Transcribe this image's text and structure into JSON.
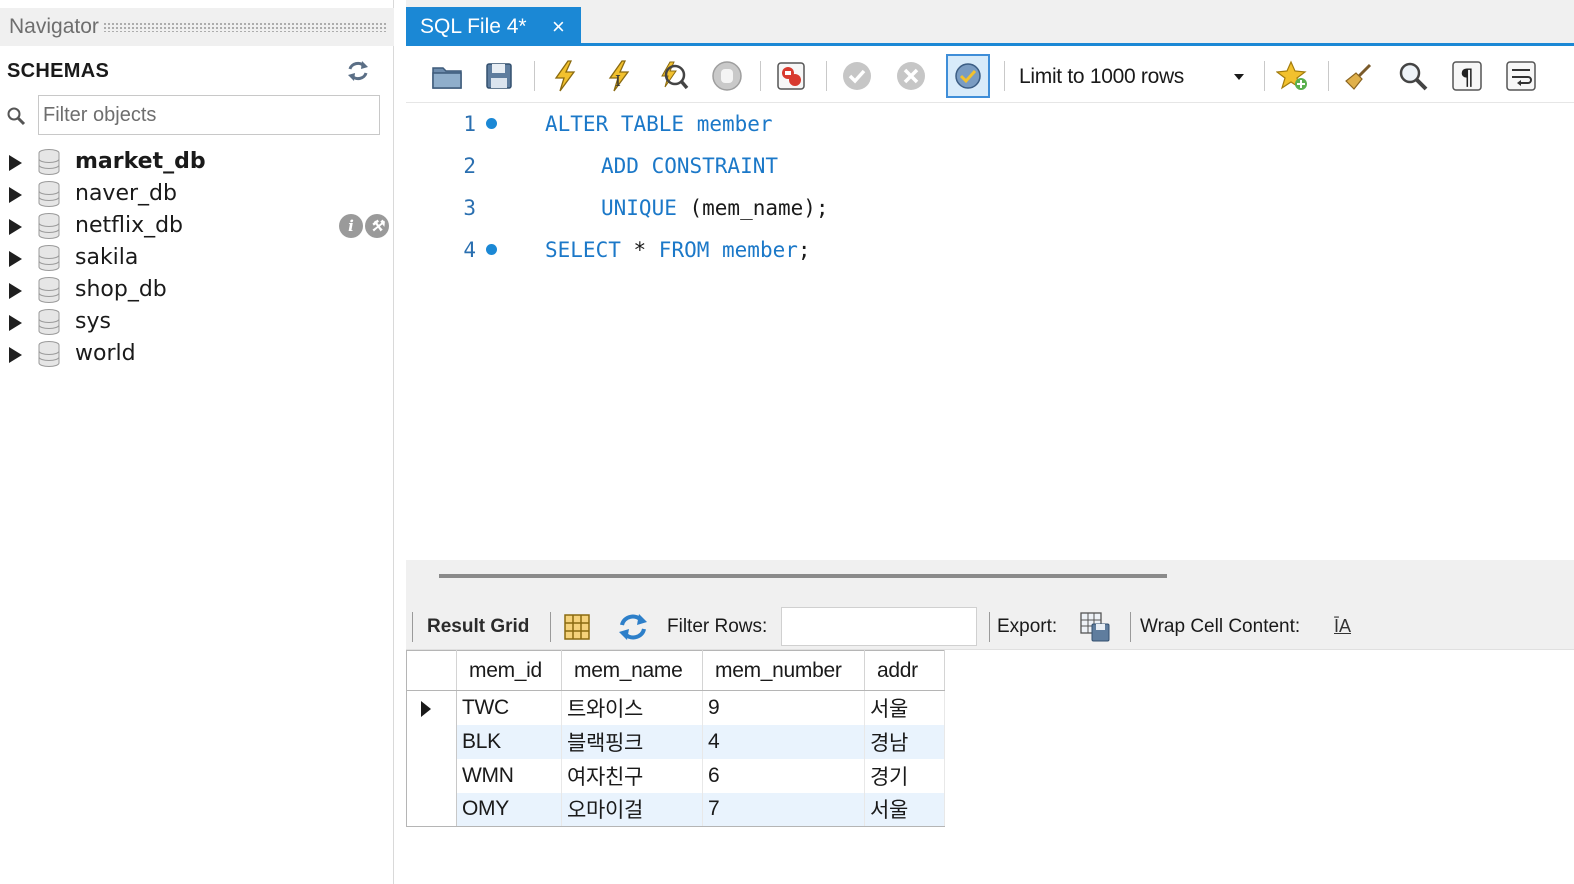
{
  "navigator": {
    "title": "Navigator",
    "schemas_label": "SCHEMAS",
    "filter_placeholder": "Filter objects",
    "schemas": [
      {
        "name": "market_db",
        "bold": true
      },
      {
        "name": "naver_db",
        "bold": false
      },
      {
        "name": "netflix_db",
        "bold": false
      },
      {
        "name": "sakila",
        "bold": false
      },
      {
        "name": "shop_db",
        "bold": false
      },
      {
        "name": "sys",
        "bold": false
      },
      {
        "name": "world",
        "bold": false
      }
    ]
  },
  "tabs": [
    {
      "label": "SQL File 4*",
      "close": "×"
    }
  ],
  "toolbar": {
    "limit_label": "Limit to 1000 rows",
    "icons": [
      "open-folder-icon",
      "save-icon",
      "execute-lightning-icon",
      "execute-cursor-lightning-icon",
      "explain-icon",
      "stop-hand-icon",
      "stop-on-error-icon",
      "commit-check-icon",
      "rollback-x-icon",
      "autocommit-toggle-icon",
      "beautify-star-icon",
      "brush-icon",
      "find-icon",
      "invisible-chars-icon",
      "wrap-lines-icon"
    ]
  },
  "editor": {
    "lines": [
      {
        "num": "1",
        "bullet": true,
        "indent": 0,
        "tokens": [
          {
            "t": "ALTER TABLE ",
            "kw": true
          },
          {
            "t": "member",
            "kw": true
          }
        ]
      },
      {
        "num": "2",
        "bullet": false,
        "indent": 1,
        "tokens": [
          {
            "t": "ADD CONSTRAINT",
            "kw": true
          }
        ]
      },
      {
        "num": "3",
        "bullet": false,
        "indent": 1,
        "tokens": [
          {
            "t": "UNIQUE",
            "kw": true
          },
          {
            "t": " (mem_name);",
            "kw": false
          }
        ]
      },
      {
        "num": "4",
        "bullet": true,
        "indent": 0,
        "tokens": [
          {
            "t": "SELECT",
            "kw": true
          },
          {
            "t": " * ",
            "kw": false
          },
          {
            "t": "FROM member",
            "kw": true
          },
          {
            "t": ";",
            "kw": false
          }
        ]
      }
    ]
  },
  "result_toolbar": {
    "result_grid_label": "Result Grid",
    "filter_rows_label": "Filter Rows:",
    "export_label": "Export:",
    "wrap_label": "Wrap Cell Content:",
    "wrap_icon_glyph": "ĪA"
  },
  "result": {
    "columns": [
      "mem_id",
      "mem_name",
      "mem_number",
      "addr"
    ],
    "rows": [
      [
        "TWC",
        "트와이스",
        "9",
        "서울"
      ],
      [
        "BLK",
        "블랙핑크",
        "4",
        "경남"
      ],
      [
        "WMN",
        "여자친구",
        "6",
        "경기"
      ],
      [
        "OMY",
        "오마이걸",
        "7",
        "서울"
      ]
    ]
  },
  "colors": {
    "accent": "#1b88d5",
    "keyword": "#1b78c8",
    "alt_row": "#e9f3fd"
  }
}
